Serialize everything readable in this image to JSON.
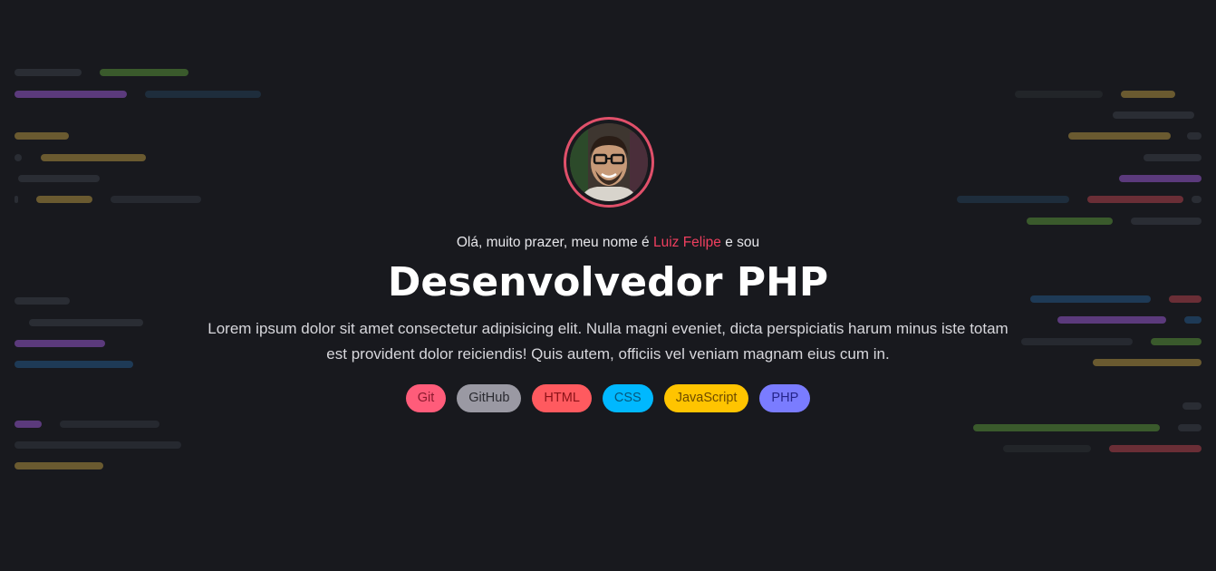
{
  "hero": {
    "intro_prefix": "Olá, muito prazer, meu nome é",
    "intro_name": "Luiz Felipe",
    "intro_suffix": "e sou",
    "title": "Desenvolvedor PHP",
    "description": "Lorem ipsum dolor sit amet consectetur adipisicing elit. Nulla magni eveniet, dicta perspiciatis harum minus iste totam est provident dolor reiciendis! Quis autem, officiis vel veniam magnam eius cum in."
  },
  "colors": {
    "background": "#18191e",
    "accent": "#ef3f5f",
    "avatar_ring": "#e0506a"
  },
  "tags": [
    {
      "label": "Git",
      "bg": "#ff5c7a",
      "fg": "#8a1a2e"
    },
    {
      "label": "GitHub",
      "bg": "#9a99a3",
      "fg": "#2a2a30"
    },
    {
      "label": "HTML",
      "bg": "#ff5a5f",
      "fg": "#8a1218"
    },
    {
      "label": "CSS",
      "bg": "#00b8ff",
      "fg": "#07567a"
    },
    {
      "label": "JavaScript",
      "bg": "#ffc400",
      "fg": "#6d4a00"
    },
    {
      "label": "PHP",
      "bg": "#7a7cff",
      "fg": "#24248a"
    }
  ]
}
